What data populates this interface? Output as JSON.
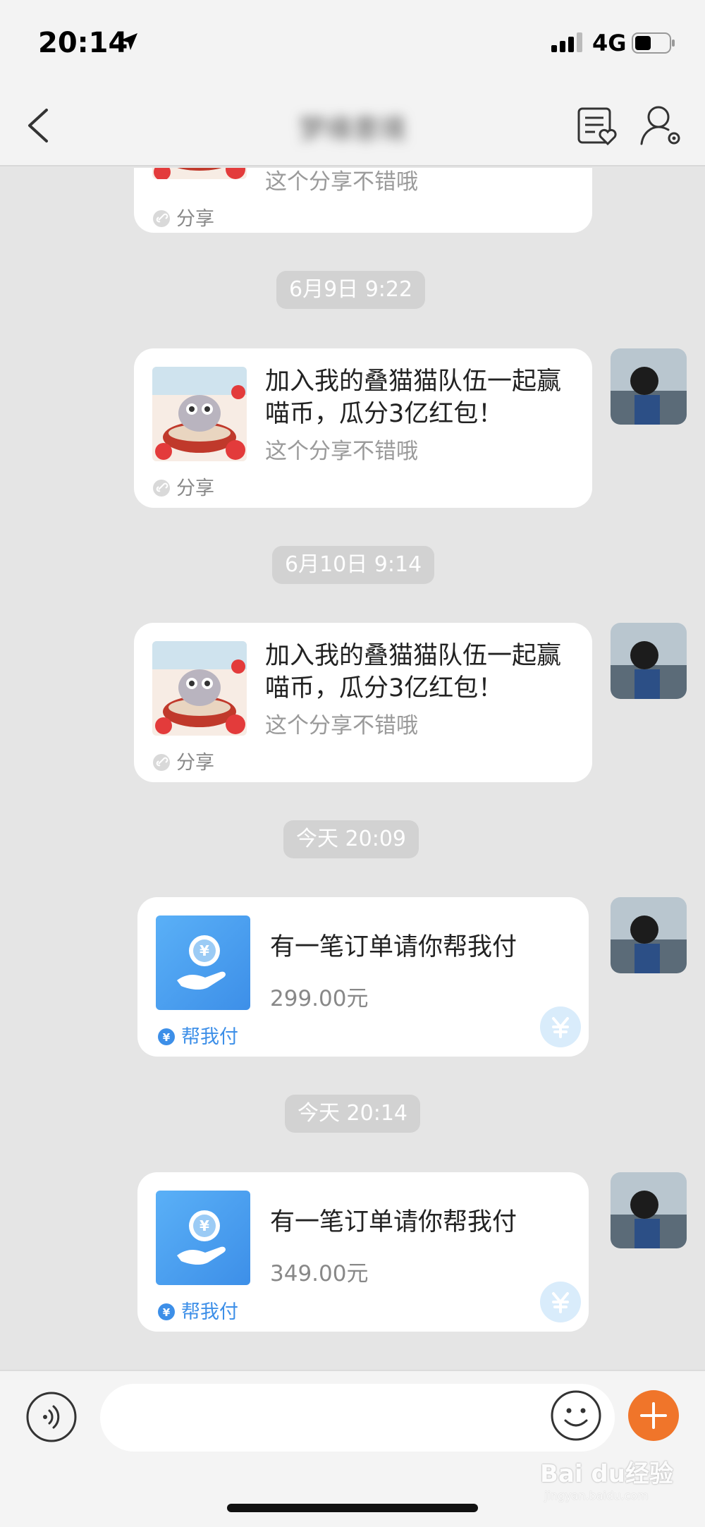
{
  "status_bar": {
    "time": "20:14",
    "network": "4G"
  },
  "header": {
    "title": "梦缘意境"
  },
  "messages": [
    {
      "type": "share",
      "title": "",
      "subtitle": "这个分享不错哦",
      "tag": "分享"
    },
    {
      "type": "time",
      "text": "6月9日 9:22"
    },
    {
      "type": "share",
      "title": "加入我的叠猫猫队伍一起赢喵币，瓜分3亿红包！",
      "subtitle": "这个分享不错哦",
      "tag": "分享"
    },
    {
      "type": "time",
      "text": "6月10日 9:14"
    },
    {
      "type": "share",
      "title": "加入我的叠猫猫队伍一起赢喵币，瓜分3亿红包！",
      "subtitle": "这个分享不错哦",
      "tag": "分享"
    },
    {
      "type": "time",
      "text": "今天 20:09"
    },
    {
      "type": "pay",
      "title": "有一笔订单请你帮我付",
      "amount": "299.00元",
      "tag": "帮我付"
    },
    {
      "type": "time",
      "text": "今天 20:14"
    },
    {
      "type": "pay",
      "title": "有一笔订单请你帮我付",
      "amount": "349.00元",
      "tag": "帮我付"
    }
  ],
  "input": {
    "placeholder": ""
  },
  "watermark": {
    "brand": "Bai du经验",
    "url": "jingyan.baidu.com"
  },
  "colors": {
    "accent_orange": "#f0752a",
    "pay_blue": "#3d8fe8",
    "pill_gray": "#d2d2d2"
  }
}
